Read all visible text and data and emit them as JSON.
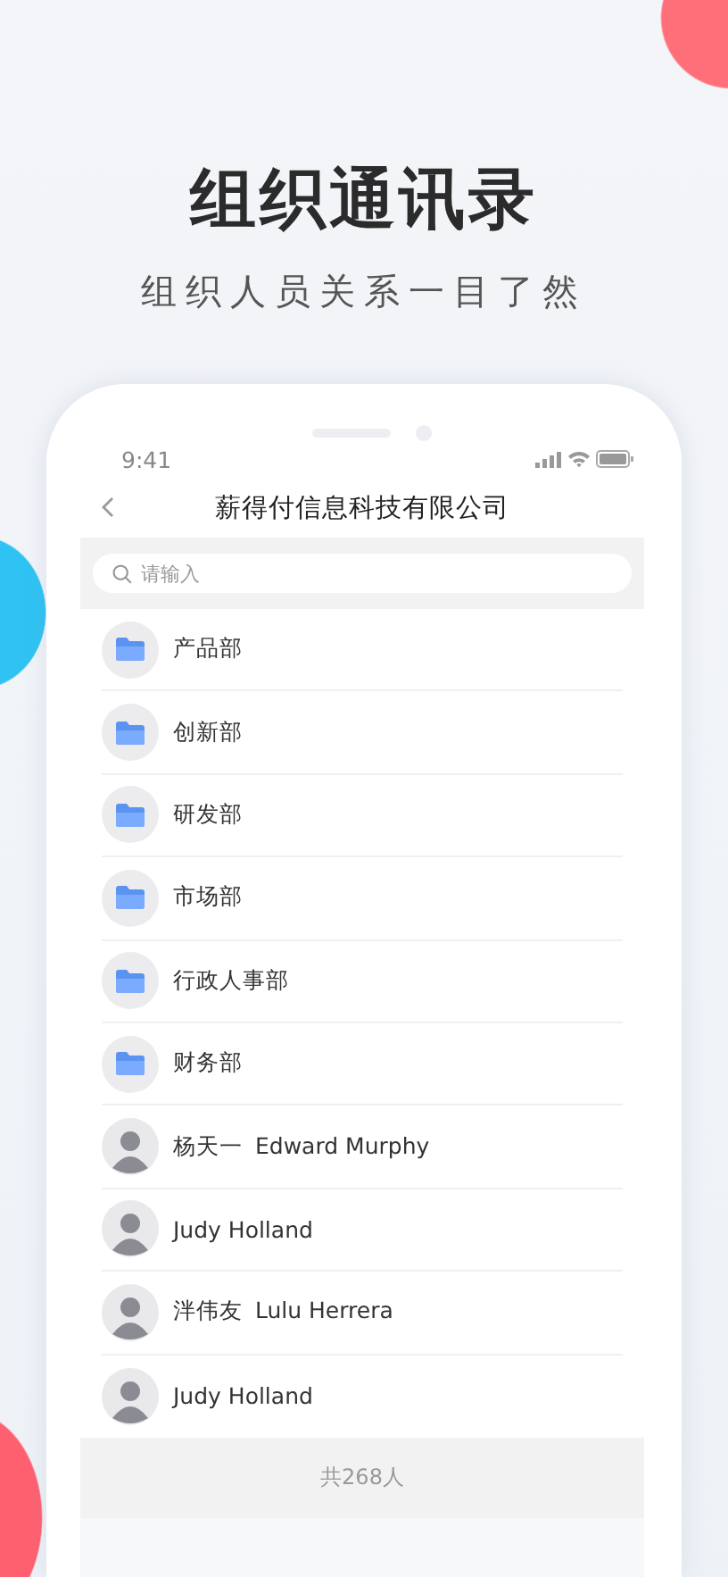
{
  "header": {
    "title": "组织通讯录",
    "subtitle": "组织人员关系一目了然"
  },
  "phone": {
    "status_time": "9:41",
    "nav_title": "薪得付信息科技有限公司",
    "search": {
      "placeholder": "请输入"
    },
    "contacts": [
      {
        "kind": "department",
        "name": "产品部"
      },
      {
        "kind": "department",
        "name": "创新部"
      },
      {
        "kind": "department",
        "name": "研发部"
      },
      {
        "kind": "department",
        "name": "市场部"
      },
      {
        "kind": "department",
        "name": "行政人事部"
      },
      {
        "kind": "department",
        "name": "财务部"
      },
      {
        "kind": "person",
        "name": "杨天一",
        "english_name": "Edward Murphy"
      },
      {
        "kind": "person",
        "name": "Judy Holland"
      },
      {
        "kind": "person",
        "name": "泮伟友",
        "english_name": "Lulu Herrera"
      },
      {
        "kind": "person",
        "name": "Judy Holland"
      }
    ],
    "footer": "共268人"
  }
}
